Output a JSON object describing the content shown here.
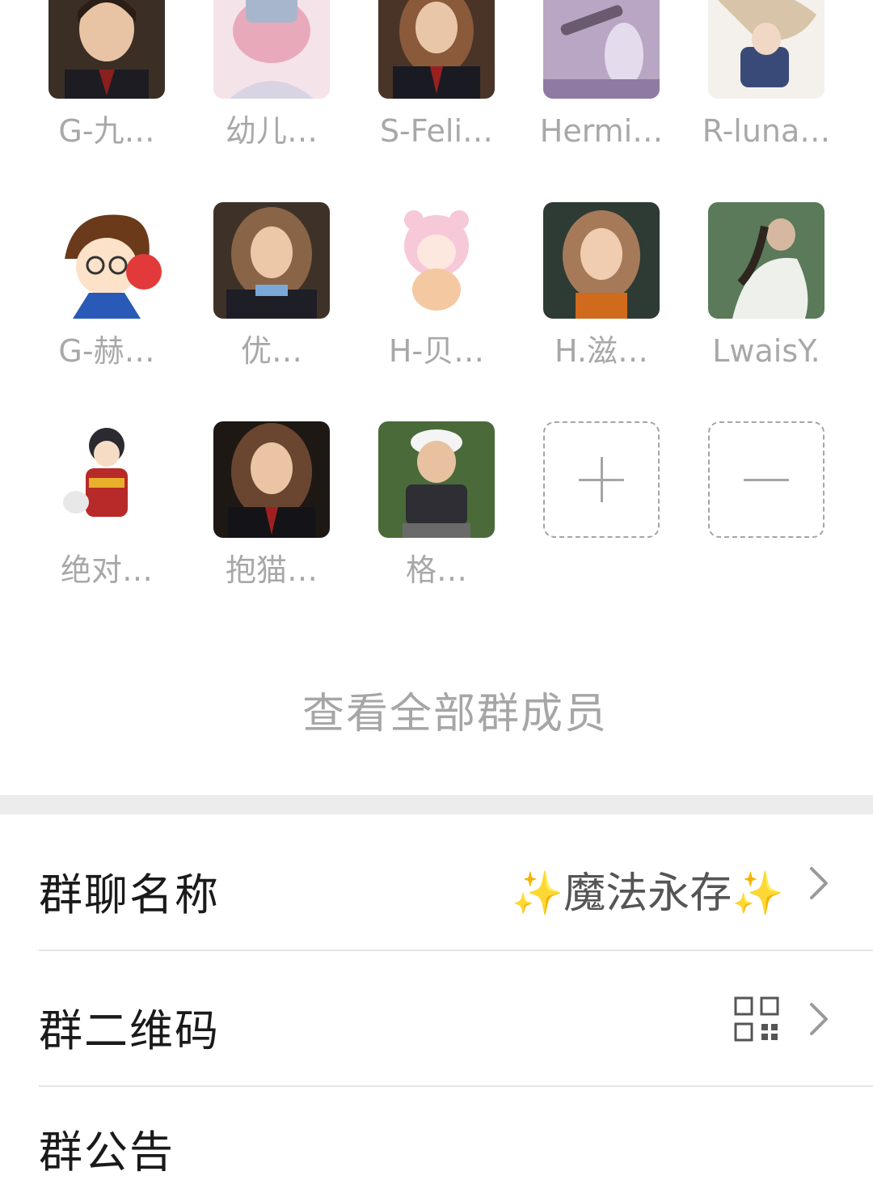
{
  "members": [
    {
      "name": "G-九…",
      "icon": "avatar-boy-wizard"
    },
    {
      "name": "幼儿…",
      "icon": "avatar-anime-pink"
    },
    {
      "name": "S-Feli…",
      "icon": "avatar-girl-robes"
    },
    {
      "name": "Hermi…",
      "icon": "avatar-telescope"
    },
    {
      "name": "R-luna…",
      "icon": "avatar-anime-white"
    },
    {
      "name": "G-赫…",
      "icon": "avatar-cartoon-headphones"
    },
    {
      "name": "优…",
      "icon": "avatar-girl-curly"
    },
    {
      "name": "H-贝…",
      "icon": "avatar-anime-bear"
    },
    {
      "name": "H.滋…",
      "icon": "avatar-girl-scarf"
    },
    {
      "name": "LwaisY.",
      "icon": "avatar-girl-green"
    },
    {
      "name": "绝对…",
      "icon": "avatar-chibi-wizard"
    },
    {
      "name": "抱猫…",
      "icon": "avatar-girl-robes-2"
    },
    {
      "name": "格…",
      "icon": "avatar-girl-cap"
    }
  ],
  "actions": {
    "add_icon": "plus-icon",
    "remove_icon": "minus-icon"
  },
  "view_all_label": "查看全部群成员",
  "settings": {
    "group_name_label": "群聊名称",
    "group_name_value": "✨魔法永存✨",
    "qr_label": "群二维码",
    "notice_label": "群公告"
  },
  "colors": {
    "muted_text": "#a8a8a8",
    "section_band": "#ececec",
    "dashed_border": "#a5a5a5"
  }
}
